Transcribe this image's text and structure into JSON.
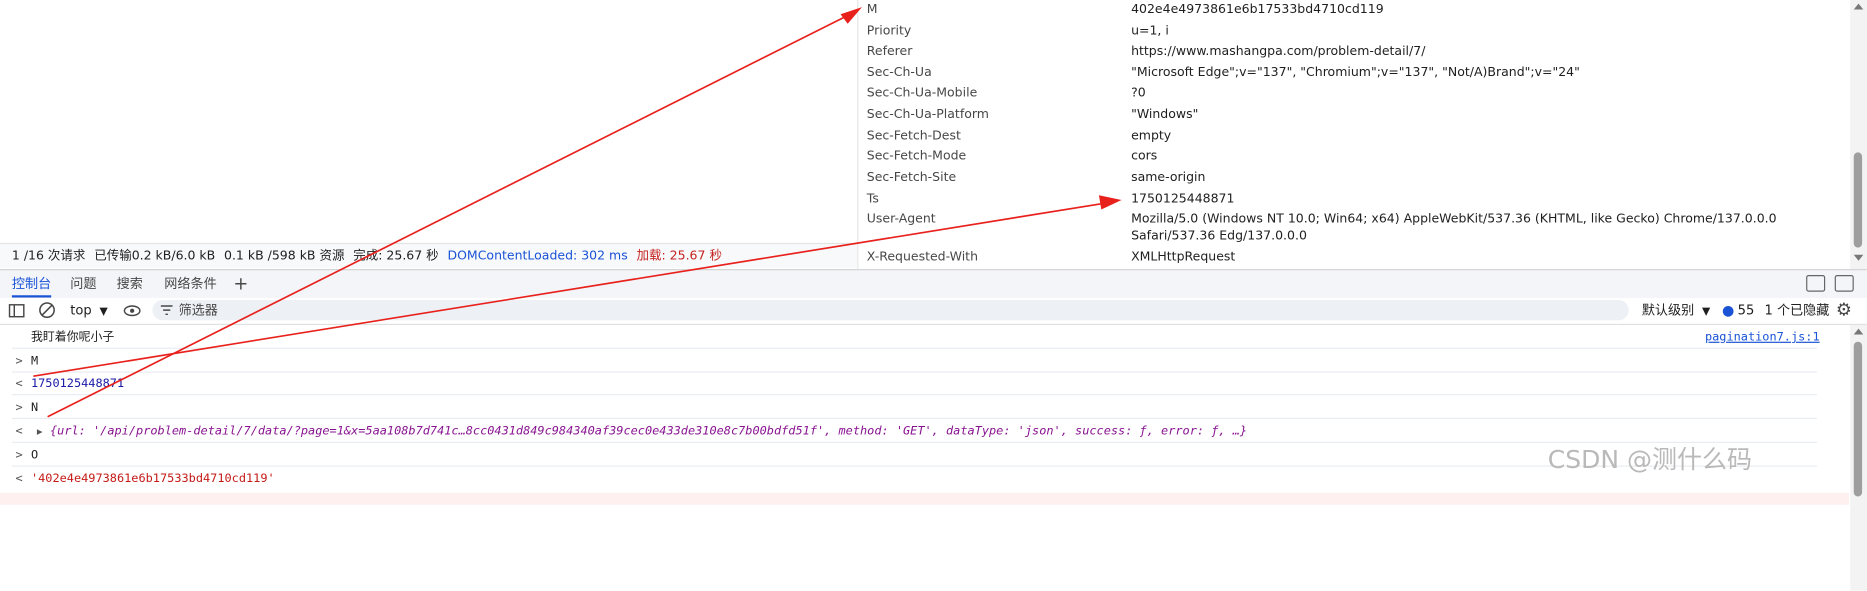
{
  "headers": [
    {
      "name": "M",
      "value": "402e4e4973861e6b17533bd4710cd119"
    },
    {
      "name": "Priority",
      "value": "u=1, i"
    },
    {
      "name": "Referer",
      "value": "https://www.mashangpa.com/problem-detail/7/"
    },
    {
      "name": "Sec-Ch-Ua",
      "value": "\"Microsoft Edge\";v=\"137\", \"Chromium\";v=\"137\", \"Not/A)Brand\";v=\"24\""
    },
    {
      "name": "Sec-Ch-Ua-Mobile",
      "value": "?0"
    },
    {
      "name": "Sec-Ch-Ua-Platform",
      "value": "\"Windows\""
    },
    {
      "name": "Sec-Fetch-Dest",
      "value": "empty"
    },
    {
      "name": "Sec-Fetch-Mode",
      "value": "cors"
    },
    {
      "name": "Sec-Fetch-Site",
      "value": "same-origin"
    },
    {
      "name": "Ts",
      "value": "1750125448871"
    },
    {
      "name": "User-Agent",
      "value": "Mozilla/5.0 (Windows NT 10.0; Win64; x64) AppleWebKit/537.36 (KHTML, like Gecko) Chrome/137.0.0.0",
      "value2": "Safari/537.36 Edg/137.0.0.0"
    },
    {
      "name": "X-Requested-With",
      "value": "XMLHttpRequest"
    }
  ],
  "status": {
    "requests": "1 /16 次请求",
    "transferred": "已传输0.2 kB/6.0 kB",
    "resources": "0.1 kB /598 kB 资源",
    "finish": "完成: 25.67 秒",
    "dcl": "DOMContentLoaded: 302 ms",
    "load": "加载: 25.67 秒"
  },
  "drawer": {
    "tabs": [
      "控制台",
      "问题",
      "搜索",
      "网络条件"
    ],
    "add": "+"
  },
  "toolbar": {
    "context": "top",
    "filter_placeholder": "筛选器",
    "levels": "默认级别",
    "issues_count": "55",
    "hidden": "1 个已隐藏"
  },
  "console": {
    "log_text": "我盯着你呢小子",
    "log_source": "pagination7.js:1",
    "lines": [
      {
        "prefix": ">",
        "text": "M"
      },
      {
        "prefix": "<",
        "text": "1750125448871"
      },
      {
        "prefix": ">",
        "text": "N"
      },
      {
        "prefix": "<",
        "text": "{url: '/api/problem-detail/7/data/?page=1&x=5aa108b7d741c…8cc0431d849c984340af39cec0e433de310e8c7b00bdfd51f', method: 'GET', dataType: 'json', success: ƒ, error: ƒ, …}"
      },
      {
        "prefix": ">",
        "text": "O"
      },
      {
        "prefix": "<",
        "text": "'402e4e4973861e6b17533bd4710cd119'"
      }
    ]
  },
  "watermark": "CSDN @测什么码",
  "colors": {
    "accent": "#1a53d6",
    "arrow": "#e8211c",
    "error": "#c5221f"
  }
}
